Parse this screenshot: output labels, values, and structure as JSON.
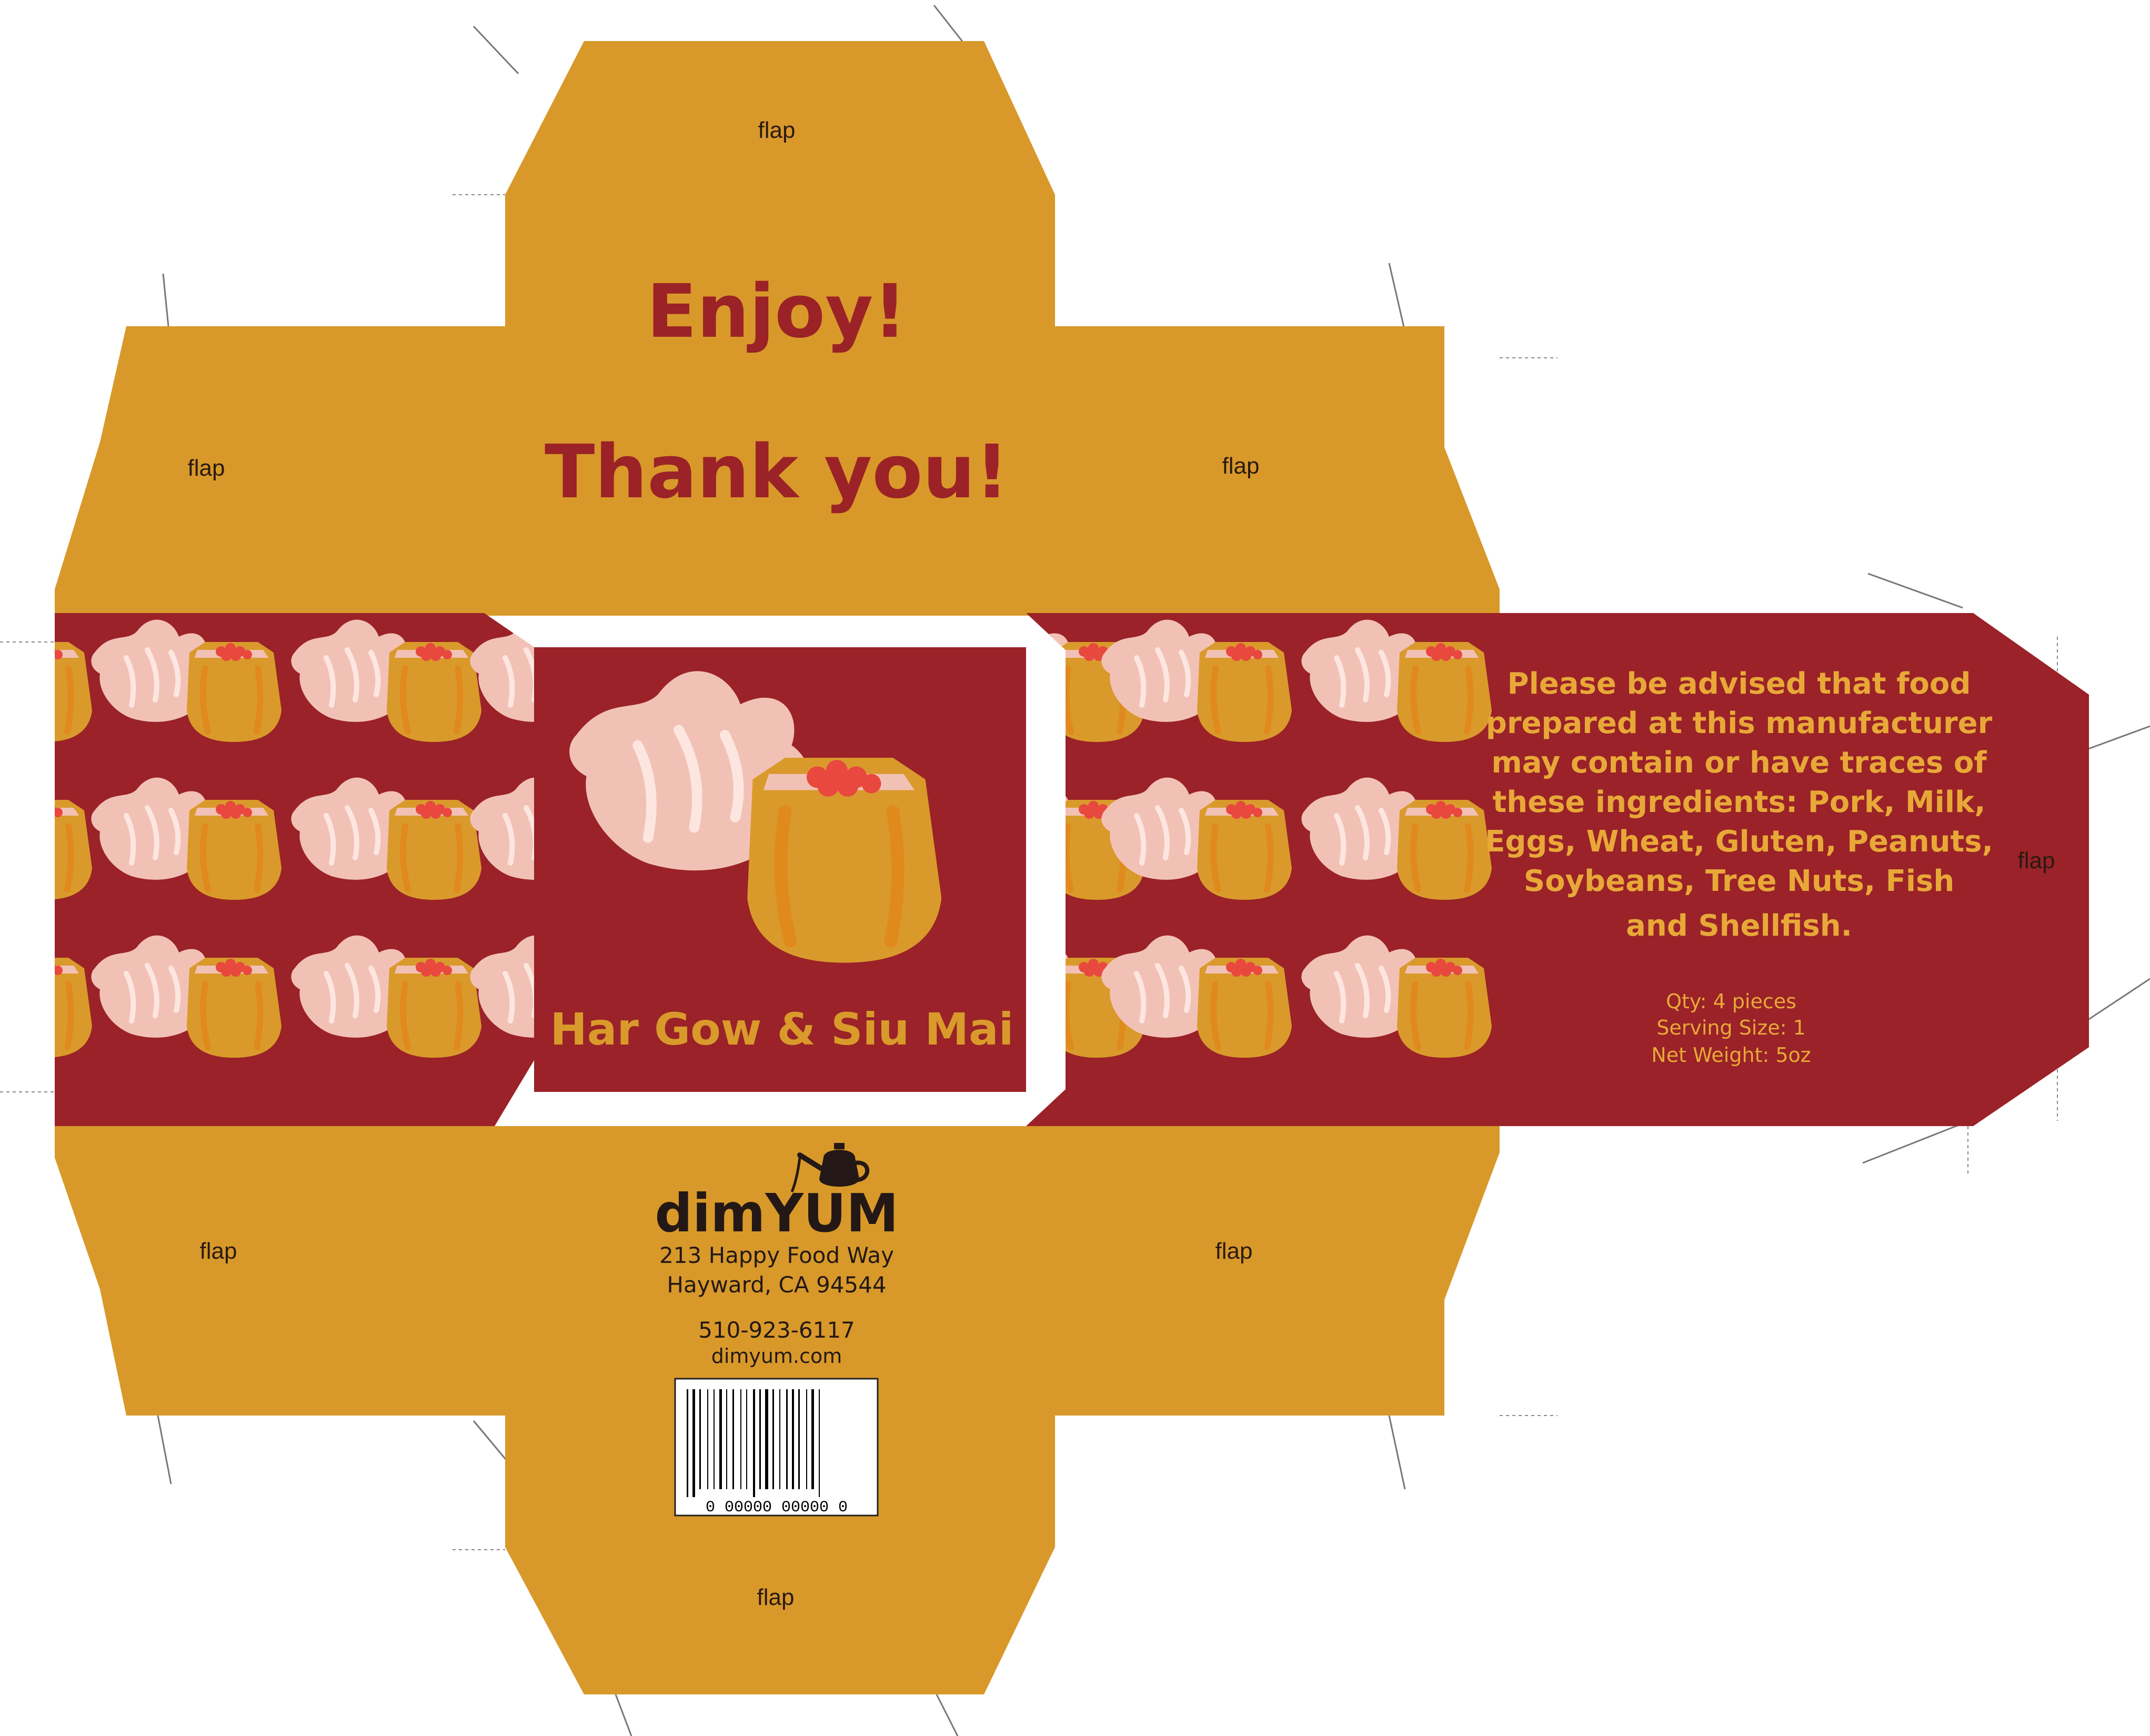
{
  "colors": {
    "gold": "#d8992a",
    "maroon": "#9a2228",
    "pink": "#f2c1b6",
    "roe": "#e8483e",
    "ink": "#231815"
  },
  "flaps": {
    "top": "flap",
    "top_left": "flap",
    "top_right": "flap",
    "bottom_left": "flap",
    "bottom_right": "flap",
    "bottom": "flap",
    "side_right": "flap"
  },
  "top_panel": {
    "line1": "Enjoy!",
    "line2": "Thank you!"
  },
  "front_panel": {
    "product_name": "Har Gow & Siu Mai"
  },
  "side_panel": {
    "allergen_lines": [
      "Please be advised that food",
      "prepared at this manufacturer",
      "may contain or have traces of",
      "these ingredients: Pork, Milk,",
      "Eggs, Wheat, Gluten, Peanuts,",
      "Soybeans, Tree Nuts, Fish",
      "and Shellfish."
    ],
    "qty": "Qty: 4 pieces",
    "serving_size": "Serving Size: 1",
    "net_weight": "Net Weight: 5oz"
  },
  "bottom_panel": {
    "logo": "dimYUM",
    "address_line1": "213 Happy Food Way",
    "address_line2": "Hayward, CA 94544",
    "phone": "510-923-6117",
    "website": "dimyum.com",
    "barcode_number": "0  00000  00000  0"
  }
}
